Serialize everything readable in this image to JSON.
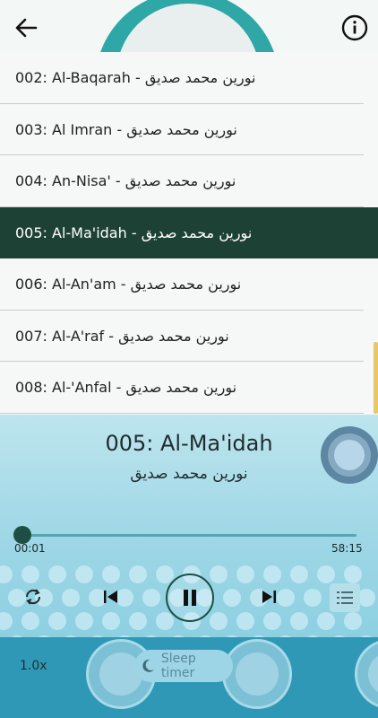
{
  "header": {
    "back_icon": "arrow-left-icon",
    "info_icon": "info-circle-icon"
  },
  "surahs": [
    {
      "label": "002: Al-Baqarah - نورين محمد صديق"
    },
    {
      "label": "003: Al Imran - نورين محمد صديق"
    },
    {
      "label": "004: An-Nisa' - نورين محمد صديق"
    },
    {
      "label": "005: Al-Ma'idah - نورين محمد صديق",
      "active": true
    },
    {
      "label": "006: Al-An'am - نورين محمد صديق"
    },
    {
      "label": "007: Al-A'raf - نورين محمد صديق"
    },
    {
      "label": "008: Al-'Anfal - نورين محمد صديق"
    }
  ],
  "player": {
    "title": "005: Al-Ma'idah",
    "artist": "نورين محمد صديق",
    "current_time": "00:01",
    "total_time": "58:15",
    "progress": 0.0,
    "speed": "1.0x",
    "sleep_label": "Sleep timer"
  },
  "colors": {
    "active_row": "#1e4136",
    "accent": "#1e4f44",
    "player_bg": "#9fd7e6"
  }
}
